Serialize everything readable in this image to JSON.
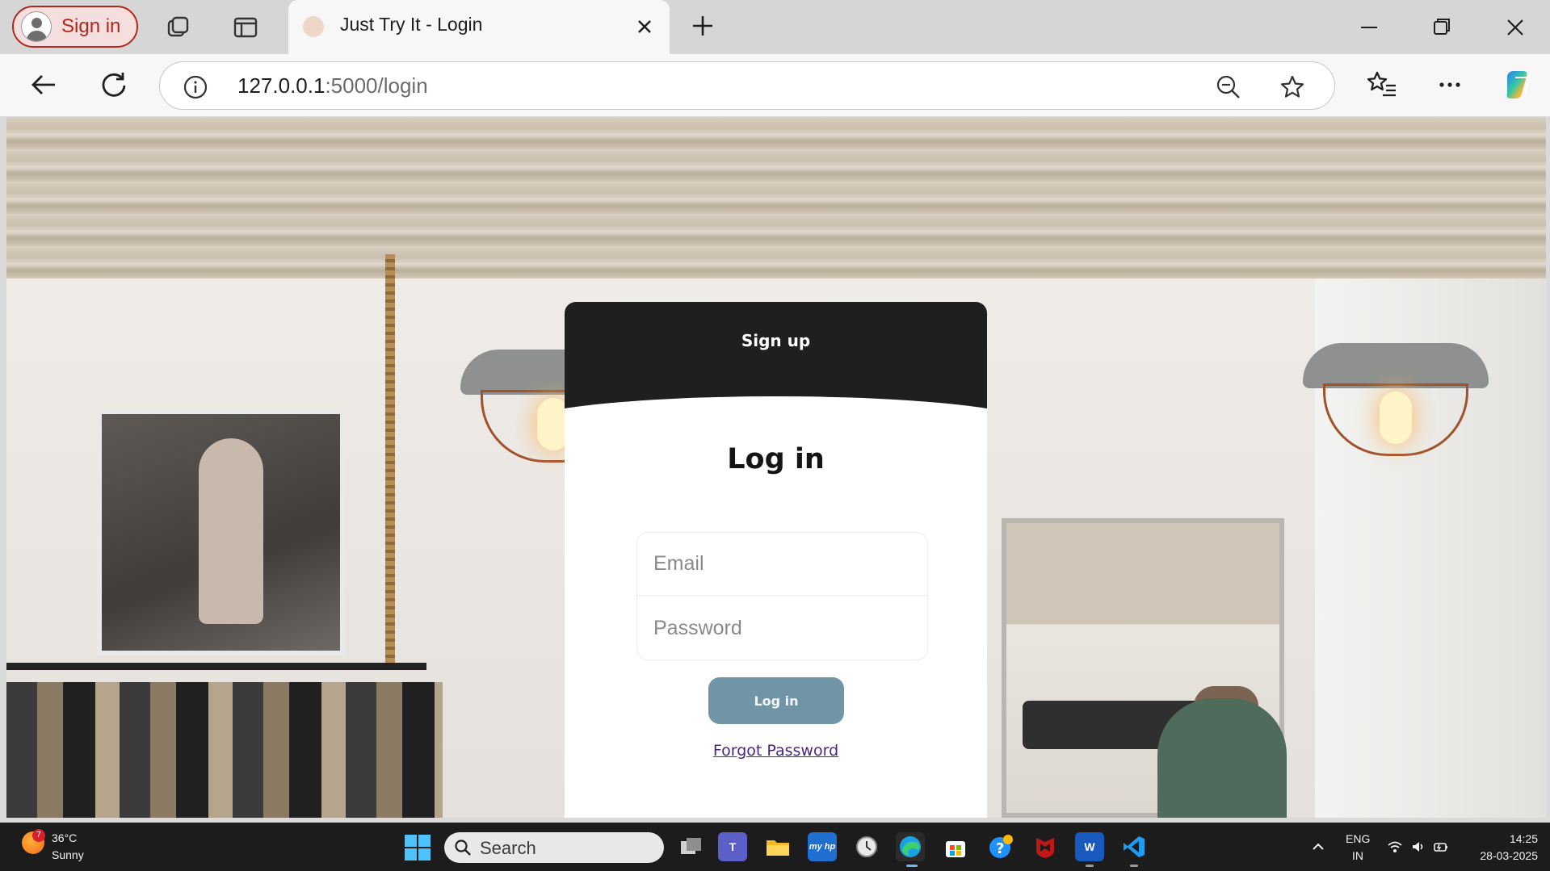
{
  "browser": {
    "profile_label": "Sign in",
    "tab_title": "Just Try It - Login",
    "url_host": "127.0.0.1",
    "url_path": ":5000/login"
  },
  "page": {
    "signup_label": "Sign up",
    "title": "Log in",
    "email_placeholder": "Email",
    "password_placeholder": "Password",
    "login_button": "Log in",
    "forgot_link": "Forgot Password"
  },
  "taskbar": {
    "weather_badge": "7",
    "weather_temp": "36°C",
    "weather_desc": "Sunny",
    "search_label": "Search",
    "language_line1": "ENG",
    "language_line2": "IN",
    "time": "14:25",
    "date": "28-03-2025"
  },
  "colors": {
    "card_header": "#1f1f1f",
    "login_button": "#6f95a6",
    "link": "#4b2680",
    "profile_accent": "#b3261e"
  }
}
